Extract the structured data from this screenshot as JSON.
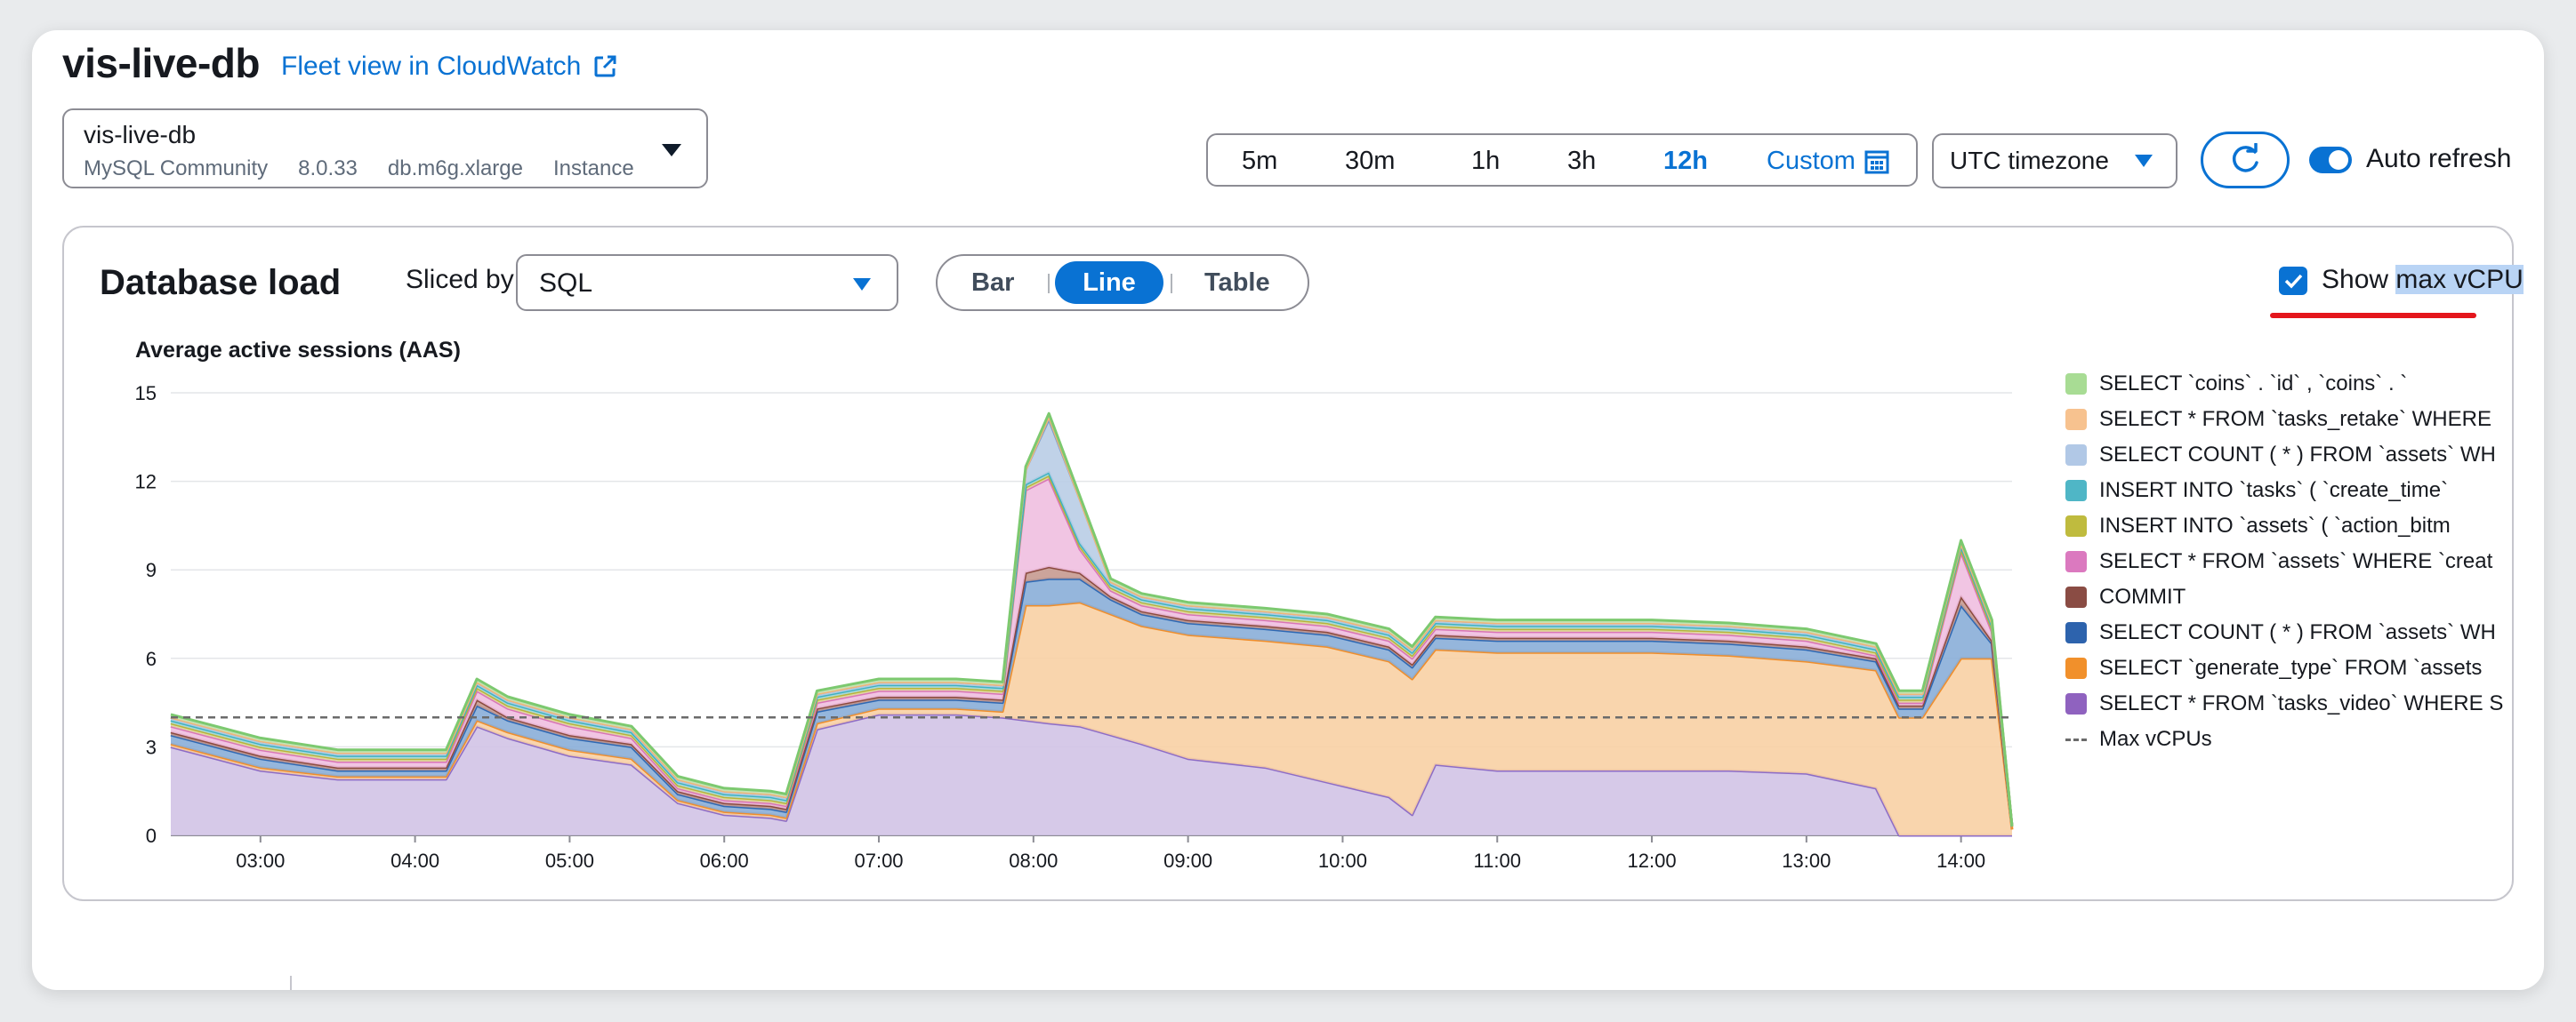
{
  "header": {
    "title": "vis-live-db",
    "cloudwatch_link": "Fleet view in CloudWatch"
  },
  "instance": {
    "name": "vis-live-db",
    "engine": "MySQL Community",
    "version": "8.0.33",
    "class": "db.m6g.xlarge",
    "type": "Instance"
  },
  "time_range": {
    "options": [
      "5m",
      "30m",
      "1h",
      "3h",
      "12h"
    ],
    "selected": "12h",
    "custom_label": "Custom"
  },
  "timezone": {
    "selected": "UTC timezone"
  },
  "auto_refresh": {
    "label": "Auto refresh",
    "enabled": true
  },
  "panel": {
    "title": "Database load",
    "sliced_by_label": "Sliced by",
    "sliced_by_value": "SQL",
    "views": [
      "Bar",
      "Line",
      "Table"
    ],
    "active_view": "Line",
    "show_max_vcpu": {
      "checked": true,
      "label_prefix": "Show ",
      "label_highlight": "max vCPU"
    }
  },
  "chart_data": {
    "type": "area",
    "stacked": true,
    "ylabel": "Average active sessions (AAS)",
    "yticks": [
      0,
      3,
      6,
      9,
      12,
      15
    ],
    "ylim": [
      0,
      15
    ],
    "xticks": [
      "03:00",
      "04:00",
      "05:00",
      "06:00",
      "07:00",
      "08:00",
      "09:00",
      "10:00",
      "11:00",
      "12:00",
      "13:00",
      "14:00"
    ],
    "x_range_hours": [
      2.42,
      14.33
    ],
    "max_vcpu": 4,
    "grid": true,
    "legend_placement": "right",
    "x": [
      2.42,
      3.0,
      3.5,
      3.8,
      4.2,
      4.4,
      4.6,
      5.0,
      5.4,
      5.7,
      6.0,
      6.3,
      6.4,
      6.6,
      7.0,
      7.5,
      7.8,
      7.95,
      8.1,
      8.3,
      8.5,
      8.7,
      9.0,
      9.5,
      9.9,
      10.3,
      10.45,
      10.6,
      11.0,
      11.5,
      12.0,
      12.5,
      13.0,
      13.45,
      13.6,
      13.75,
      14.0,
      14.2,
      14.33
    ],
    "series": [
      {
        "name": "SELECT * FROM `tasks_video` WHERE S",
        "color": "#8d6cc6",
        "fill": "#d2c3e6",
        "values": [
          3.0,
          2.2,
          1.9,
          1.9,
          1.9,
          3.7,
          3.3,
          2.7,
          2.4,
          1.1,
          0.7,
          0.6,
          0.5,
          3.6,
          4.1,
          4.1,
          4.0,
          3.9,
          3.8,
          3.7,
          3.4,
          3.1,
          2.6,
          2.3,
          1.8,
          1.3,
          0.7,
          2.4,
          2.2,
          2.2,
          2.2,
          2.2,
          2.1,
          1.6,
          0.0,
          0.0,
          0.0,
          0.0,
          0.0
        ]
      },
      {
        "name": "SELECT `generate_type` FROM `assets",
        "color": "#f08e2b",
        "fill": "#f8d0a4",
        "values": [
          0.1,
          0.1,
          0.1,
          0.1,
          0.1,
          0.2,
          0.2,
          0.2,
          0.2,
          0.1,
          0.1,
          0.1,
          0.1,
          0.2,
          0.2,
          0.2,
          0.2,
          3.9,
          4.0,
          4.2,
          4.1,
          4.0,
          4.2,
          4.3,
          4.6,
          4.6,
          4.6,
          3.9,
          4.0,
          4.0,
          4.0,
          3.9,
          3.8,
          4.0,
          4.0,
          4.0,
          6.0,
          6.0,
          0.2
        ]
      },
      {
        "name": "SELECT COUNT ( * ) FROM `assets` WH",
        "color": "#2e69b4",
        "fill": "#8aaed8",
        "values": [
          0.3,
          0.3,
          0.2,
          0.2,
          0.2,
          0.5,
          0.4,
          0.4,
          0.4,
          0.2,
          0.2,
          0.2,
          0.2,
          0.4,
          0.3,
          0.3,
          0.3,
          0.8,
          0.9,
          0.8,
          0.5,
          0.4,
          0.4,
          0.4,
          0.4,
          0.4,
          0.4,
          0.4,
          0.4,
          0.4,
          0.4,
          0.4,
          0.4,
          0.3,
          0.3,
          0.3,
          1.8,
          0.5,
          0.1
        ]
      },
      {
        "name": "COMMIT",
        "color": "#8b4a3f",
        "fill": "#c79a90",
        "values": [
          0.1,
          0.1,
          0.1,
          0.1,
          0.1,
          0.2,
          0.1,
          0.1,
          0.1,
          0.1,
          0.1,
          0.1,
          0.1,
          0.1,
          0.1,
          0.1,
          0.1,
          0.3,
          0.4,
          0.2,
          0.1,
          0.1,
          0.1,
          0.1,
          0.1,
          0.1,
          0.1,
          0.1,
          0.1,
          0.1,
          0.1,
          0.1,
          0.1,
          0.1,
          0.1,
          0.1,
          0.3,
          0.1,
          0.0
        ]
      },
      {
        "name": "SELECT * FROM `assets` WHERE `creat",
        "color": "#d974b8",
        "fill": "#efbfe0",
        "values": [
          0.2,
          0.2,
          0.2,
          0.2,
          0.2,
          0.3,
          0.3,
          0.3,
          0.2,
          0.1,
          0.1,
          0.1,
          0.1,
          0.2,
          0.2,
          0.2,
          0.2,
          2.8,
          3.0,
          0.8,
          0.2,
          0.2,
          0.2,
          0.2,
          0.2,
          0.2,
          0.2,
          0.2,
          0.2,
          0.2,
          0.2,
          0.2,
          0.2,
          0.1,
          0.1,
          0.1,
          1.5,
          0.3,
          0.0
        ]
      },
      {
        "name": "INSERT INTO `assets` ( `action_bitm",
        "color": "#b8b43a",
        "fill": "#e1dea0",
        "values": [
          0.1,
          0.1,
          0.1,
          0.1,
          0.1,
          0.1,
          0.1,
          0.1,
          0.1,
          0.1,
          0.1,
          0.1,
          0.1,
          0.1,
          0.1,
          0.1,
          0.1,
          0.1,
          0.1,
          0.1,
          0.1,
          0.1,
          0.1,
          0.1,
          0.1,
          0.1,
          0.1,
          0.1,
          0.1,
          0.1,
          0.1,
          0.1,
          0.1,
          0.1,
          0.1,
          0.1,
          0.1,
          0.1,
          0.0
        ]
      },
      {
        "name": "INSERT INTO `tasks` ( `create_time`",
        "color": "#3fb2c2",
        "fill": "#a8dce3",
        "values": [
          0.1,
          0.1,
          0.1,
          0.1,
          0.1,
          0.1,
          0.1,
          0.1,
          0.1,
          0.1,
          0.1,
          0.1,
          0.1,
          0.1,
          0.1,
          0.1,
          0.1,
          0.1,
          0.1,
          0.1,
          0.1,
          0.1,
          0.1,
          0.1,
          0.1,
          0.1,
          0.1,
          0.1,
          0.1,
          0.1,
          0.1,
          0.1,
          0.1,
          0.1,
          0.1,
          0.1,
          0.1,
          0.1,
          0.0
        ]
      },
      {
        "name": "SELECT COUNT ( * ) FROM `assets` WH",
        "color": "#7c9ec9",
        "fill": "#b9cde5",
        "values": [
          0.1,
          0.1,
          0.1,
          0.1,
          0.1,
          0.1,
          0.1,
          0.1,
          0.1,
          0.1,
          0.1,
          0.1,
          0.1,
          0.1,
          0.1,
          0.1,
          0.1,
          0.5,
          1.8,
          1.5,
          0.1,
          0.1,
          0.1,
          0.1,
          0.1,
          0.1,
          0.1,
          0.1,
          0.1,
          0.1,
          0.1,
          0.1,
          0.1,
          0.1,
          0.1,
          0.1,
          0.1,
          0.1,
          0.0
        ]
      },
      {
        "name": "SELECT * FROM `tasks_retake` WHERE",
        "color": "#f2b479",
        "fill": "#f9dcbd",
        "values": [
          0.0,
          0.0,
          0.0,
          0.0,
          0.0,
          0.0,
          0.0,
          0.0,
          0.0,
          0.0,
          0.0,
          0.0,
          0.0,
          0.0,
          0.0,
          0.0,
          0.0,
          0.0,
          0.1,
          0.0,
          0.0,
          0.0,
          0.0,
          0.0,
          0.0,
          0.0,
          0.0,
          0.0,
          0.0,
          0.0,
          0.0,
          0.0,
          0.0,
          0.0,
          0.0,
          0.0,
          0.0,
          0.0,
          0.0
        ]
      },
      {
        "name": "SELECT `coins` . `id` , `coins` . `",
        "color": "#7cc96f",
        "fill": "#c2e6b8",
        "values": [
          0.1,
          0.1,
          0.1,
          0.1,
          0.1,
          0.1,
          0.1,
          0.1,
          0.1,
          0.1,
          0.1,
          0.1,
          0.1,
          0.1,
          0.1,
          0.1,
          0.1,
          0.1,
          0.1,
          0.1,
          0.1,
          0.1,
          0.1,
          0.1,
          0.1,
          0.1,
          0.1,
          0.1,
          0.1,
          0.1,
          0.1,
          0.1,
          0.1,
          0.1,
          0.1,
          0.1,
          0.1,
          0.1,
          0.0
        ]
      }
    ],
    "legend": [
      {
        "label": "SELECT `coins` . `id` , `coins` . `",
        "color": "#a8dc94"
      },
      {
        "label": "SELECT * FROM `tasks_retake` WHERE",
        "color": "#f7c28f"
      },
      {
        "label": "SELECT COUNT ( * ) FROM `assets` WH",
        "color": "#b1c8e6"
      },
      {
        "label": "INSERT INTO `tasks` ( `create_time`",
        "color": "#4fb6c6"
      },
      {
        "label": "INSERT INTO `assets` ( `action_bitm",
        "color": "#bfbb3e"
      },
      {
        "label": "SELECT * FROM `assets` WHERE `creat",
        "color": "#db79bf"
      },
      {
        "label": "COMMIT",
        "color": "#8a4c44"
      },
      {
        "label": "SELECT COUNT ( * ) FROM `assets` WH",
        "color": "#2d63ad"
      },
      {
        "label": "SELECT `generate_type` FROM `assets",
        "color": "#f1902b"
      },
      {
        "label": "SELECT * FROM `tasks_video` WHERE S",
        "color": "#8f62bf"
      },
      {
        "label": "Max vCPUs",
        "color": "#6b6b6b",
        "dashed": true
      }
    ]
  },
  "colors": {
    "accent": "#0972d3",
    "annotation": "#e4161c"
  }
}
